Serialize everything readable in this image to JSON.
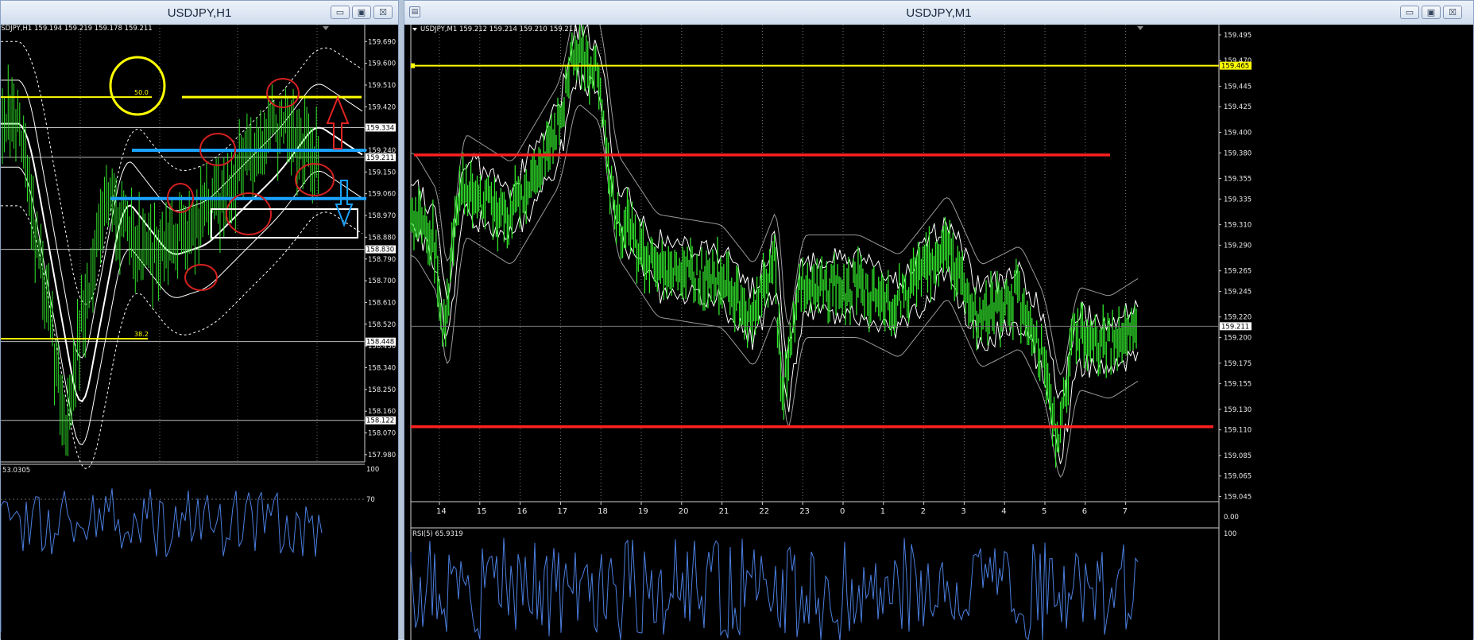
{
  "left_window": {
    "title": "USDJPY,H1",
    "ohlc_label": "USDJPY,H1  159.194 159.219 159.178 159.211",
    "sub_label": "53.0305",
    "buttons": {
      "minimize": "▭",
      "restore": "▣",
      "close": "☒"
    }
  },
  "right_window": {
    "title": "USDJPY,M1",
    "ohlc_label": "USDJPY,M1  159.212 159.214 159.210 159.211",
    "sub_label": "RSI(5) 65.9319",
    "buttons": {
      "minimize": "▭",
      "restore": "▣",
      "close": "☒"
    }
  },
  "chart_data": [
    {
      "type": "line",
      "name": "USDJPY,H1",
      "price_ticks": [
        159.69,
        159.6,
        159.51,
        159.42,
        159.33,
        159.24,
        159.15,
        159.06,
        158.97,
        158.88,
        158.79,
        158.7,
        158.61,
        158.52,
        158.43,
        158.34,
        158.25,
        158.16,
        158.07,
        157.98
      ],
      "ylim": [
        157.95,
        159.76
      ],
      "price_markers": [
        {
          "value": 159.334,
          "label": "159.334",
          "style": "grey-line"
        },
        {
          "value": 159.211,
          "label": "159.211",
          "style": "current"
        },
        {
          "value": 158.83,
          "label": "158.830",
          "style": "grey-line"
        },
        {
          "value": 158.448,
          "label": "158.448",
          "style": "grey-line"
        },
        {
          "value": 158.122,
          "label": "158.122",
          "style": "grey-line"
        }
      ],
      "fibo_levels": [
        {
          "value": 159.46,
          "label": "50.0"
        },
        {
          "value": 158.46,
          "label": "38.2"
        }
      ],
      "support_resistance_blue": [
        159.24,
        159.04
      ],
      "rsi_panel": {
        "ticks": [
          100,
          70
        ],
        "value": 53.0305
      },
      "colors": {
        "candles": "#31e62b",
        "fibo": "#ffff00",
        "sr": "#1aa3ff",
        "annotation": "#d42020",
        "box": "#ffffff",
        "rsi": "#4b7fe0"
      }
    },
    {
      "type": "line",
      "name": "USDJPY,M1",
      "price_ticks": [
        159.495,
        159.47,
        159.445,
        159.425,
        159.4,
        159.38,
        159.355,
        159.335,
        159.31,
        159.29,
        159.265,
        159.245,
        159.22,
        159.2,
        159.175,
        159.155,
        159.13,
        159.11,
        159.085,
        159.065,
        159.045
      ],
      "ylim": [
        159.04,
        159.505
      ],
      "x_ticks": [
        "14",
        "15",
        "16",
        "17",
        "18",
        "19",
        "20",
        "21",
        "22",
        "23",
        "0",
        "1",
        "2",
        "3",
        "4",
        "5",
        "6",
        "7"
      ],
      "price_markers": [
        {
          "value": 159.465,
          "label": "159.465",
          "style": "yellow-line"
        },
        {
          "value": 159.211,
          "label": "159.211",
          "style": "current"
        }
      ],
      "horizontal_lines_red": [
        159.378,
        159.113
      ],
      "rsi_panel": {
        "ticks": [
          100,
          0.0
        ],
        "value": 65.9319
      },
      "colors": {
        "candles": "#31e62b",
        "bands": "#ffffff",
        "hline": "#ff2020",
        "level": "#ffff00"
      }
    }
  ]
}
